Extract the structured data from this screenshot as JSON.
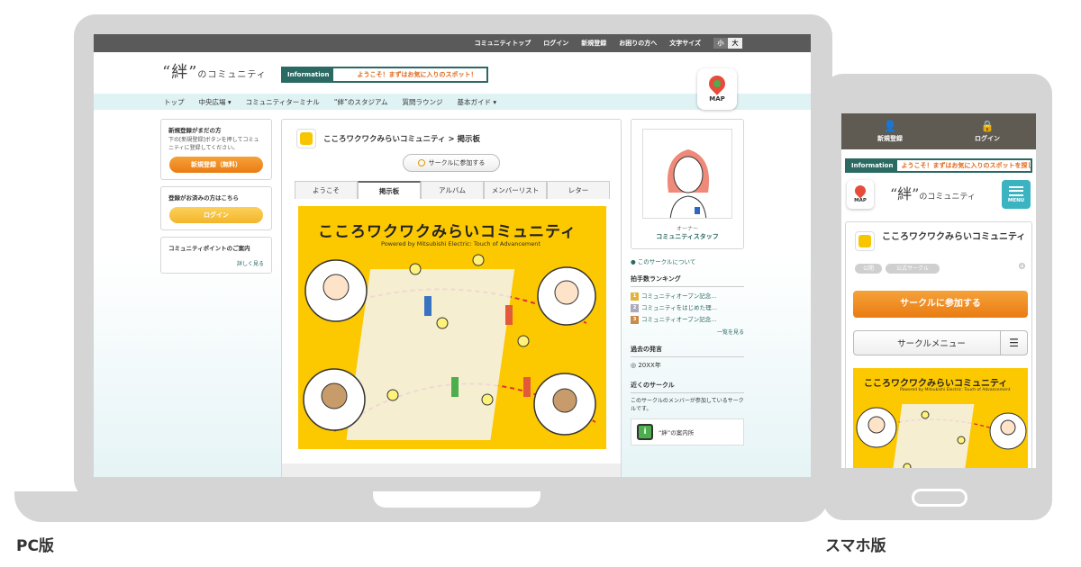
{
  "pc": {
    "caption": "PC版",
    "util": [
      "コミュニティトップ",
      "ログイン",
      "新規登録",
      "お困りの方へ",
      "文字サイズ"
    ],
    "fontsize": {
      "small": "小",
      "large": "大"
    },
    "logo": {
      "main": "“絆”",
      "sub": "のコミュニティ"
    },
    "info": {
      "label": "Information",
      "text": "ようこそ！まずはお気に入りのスポット！"
    },
    "map_label": "MAP",
    "nav": [
      "トップ",
      "中央広場 ▾",
      "コミュニティターミナル",
      "“絆”のスタジアム",
      "質問ラウンジ",
      "基本ガイド ▾"
    ],
    "left": {
      "reg_title": "新規登録がまだの方",
      "reg_text": "下の[新規登録]ボタンを押してコミュニティに登録してください。",
      "reg_button": "新規登録（無料）",
      "login_title": "登録がお済みの方はこちら",
      "login_button": "ログイン",
      "points_title": "コミュニティポイントのご案内",
      "points_more": "詳しく見る"
    },
    "center": {
      "title": "こころワクワクみらいコミュニティ > 掲示板",
      "join": "サークルに参加する",
      "tabs": [
        "ようこそ",
        "掲示板",
        "アルバム",
        "メンバーリスト",
        "レター"
      ],
      "banner_title": "こころワクワクみらいコミュニティ",
      "banner_sub": "Powered by Mitsubishi Electric: Touch of Advancement"
    },
    "right": {
      "owner_label": "オーナー",
      "owner_name": "コミュニティスタッフ",
      "about": "このサークルについて",
      "ranking_head": "拍手数ランキング",
      "ranking": [
        "コミュニティオープン記念…",
        "コミュニティをはじめた理…",
        "コミュニティオープン記念…"
      ],
      "ranking_more": "一覧を見る",
      "past_head": "過去の発言",
      "past_item": "20XX年",
      "near_head": "近くのサークル",
      "near_text": "このサークルのメンバーが参加しているサークルです。",
      "guide": "“絆”の案内所"
    }
  },
  "sp": {
    "caption": "スマホ版",
    "top": {
      "register": "新規登録",
      "login": "ログイン"
    },
    "info": {
      "label": "Information",
      "text": "ようこそ！まずはお気に入りのスポットを探し"
    },
    "map_label": "MAP",
    "menu_label": "MENU",
    "title": "こころワクワクみらいコミュニティ",
    "tags": [
      "公開",
      "公式サークル"
    ],
    "join": "サークルに参加する",
    "circle_menu": "サークルメニュー",
    "banner_title": "こころワクワクみらいコミュニティ",
    "banner_sub": "Powered by Mitsubishi Electric: Touch of Advancement"
  },
  "colors": {
    "accent": "#2b6a63",
    "orange": "#e97c12",
    "yellow": "#fcc800",
    "teal_menu": "#3cb3c0"
  }
}
